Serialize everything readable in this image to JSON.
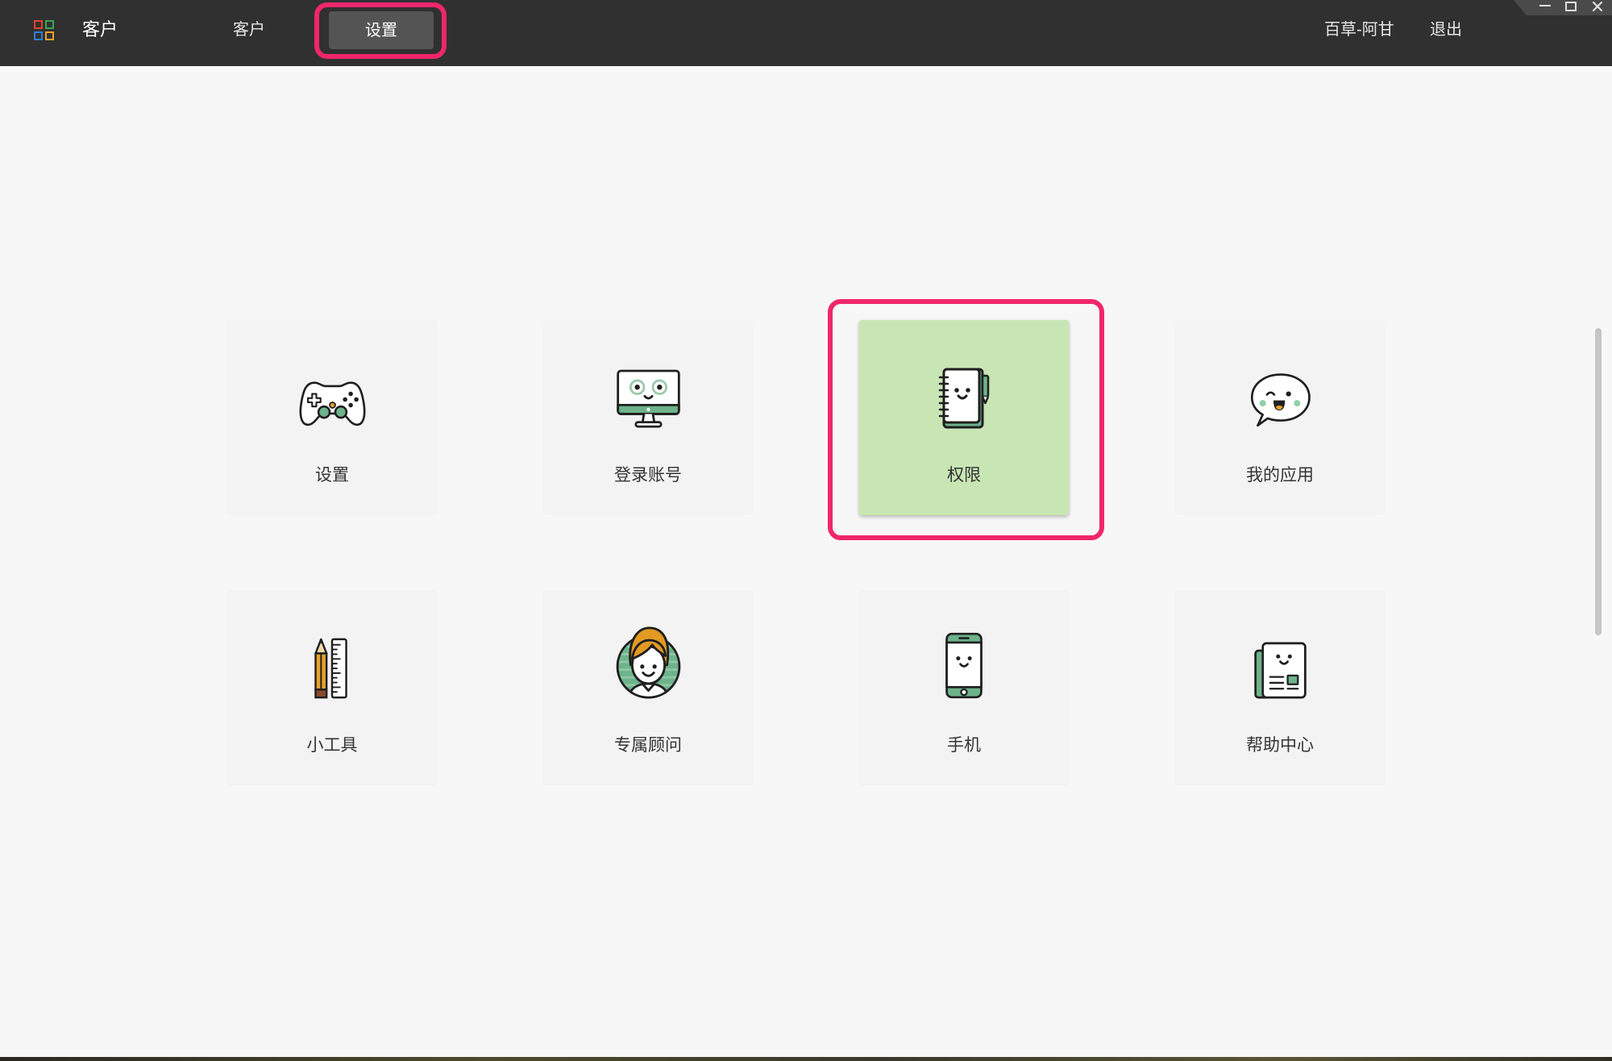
{
  "app": {
    "title": "客户",
    "logo_icon": "app-grid-icon"
  },
  "nav": {
    "items": [
      {
        "label": "客户",
        "active": false
      },
      {
        "label": "设置",
        "active": true
      }
    ]
  },
  "user": {
    "name": "百草-阿甘",
    "logout_label": "退出"
  },
  "window_controls": {
    "minimize_icon": "minimize-icon",
    "maximize_icon": "maximize-icon",
    "close_icon": "close-icon"
  },
  "tiles": [
    {
      "label": "设置",
      "icon": "gamepad-icon",
      "selected": false
    },
    {
      "label": "登录账号",
      "icon": "monitor-face-icon",
      "selected": false
    },
    {
      "label": "权限",
      "icon": "notebook-face-icon",
      "selected": true
    },
    {
      "label": "我的应用",
      "icon": "chat-bubble-face-icon",
      "selected": false
    },
    {
      "label": "小工具",
      "icon": "pencil-ruler-icon",
      "selected": false
    },
    {
      "label": "专属顾问",
      "icon": "advisor-person-icon",
      "selected": false
    },
    {
      "label": "手机",
      "icon": "phone-face-icon",
      "selected": false
    },
    {
      "label": "帮助中心",
      "icon": "help-document-icon",
      "selected": false
    }
  ],
  "colors": {
    "topbar_bg": "#303030",
    "page_bg": "#f7f7f7",
    "selected_tile_bg": "#c8e6b4",
    "highlight_border": "#f0266b",
    "icon_green": "#6db38b",
    "icon_orange": "#e6a02a",
    "logo": [
      "#e8412c",
      "#3aa655",
      "#2f7fd6",
      "#f0a12a"
    ]
  }
}
